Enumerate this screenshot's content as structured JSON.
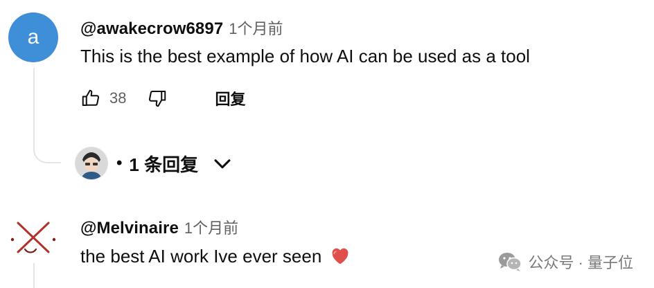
{
  "comments": [
    {
      "avatar_letter": "a",
      "handle": "@awakecrow6897",
      "time": "1个月前",
      "text": "This is the best example of how AI can be used as a tool",
      "likes": "38",
      "reply_label": "回复",
      "replies_label": "1 条回复"
    },
    {
      "handle": "@Melvinaire",
      "time": "1个月前",
      "text": "the best AI work Ive ever seen"
    }
  ],
  "watermark": {
    "text": "公众号 · 量子位"
  },
  "colors": {
    "avatar_bg": "#3f8fd8",
    "heart": "#e0504a",
    "avatar2_mark": "#b0322a"
  }
}
